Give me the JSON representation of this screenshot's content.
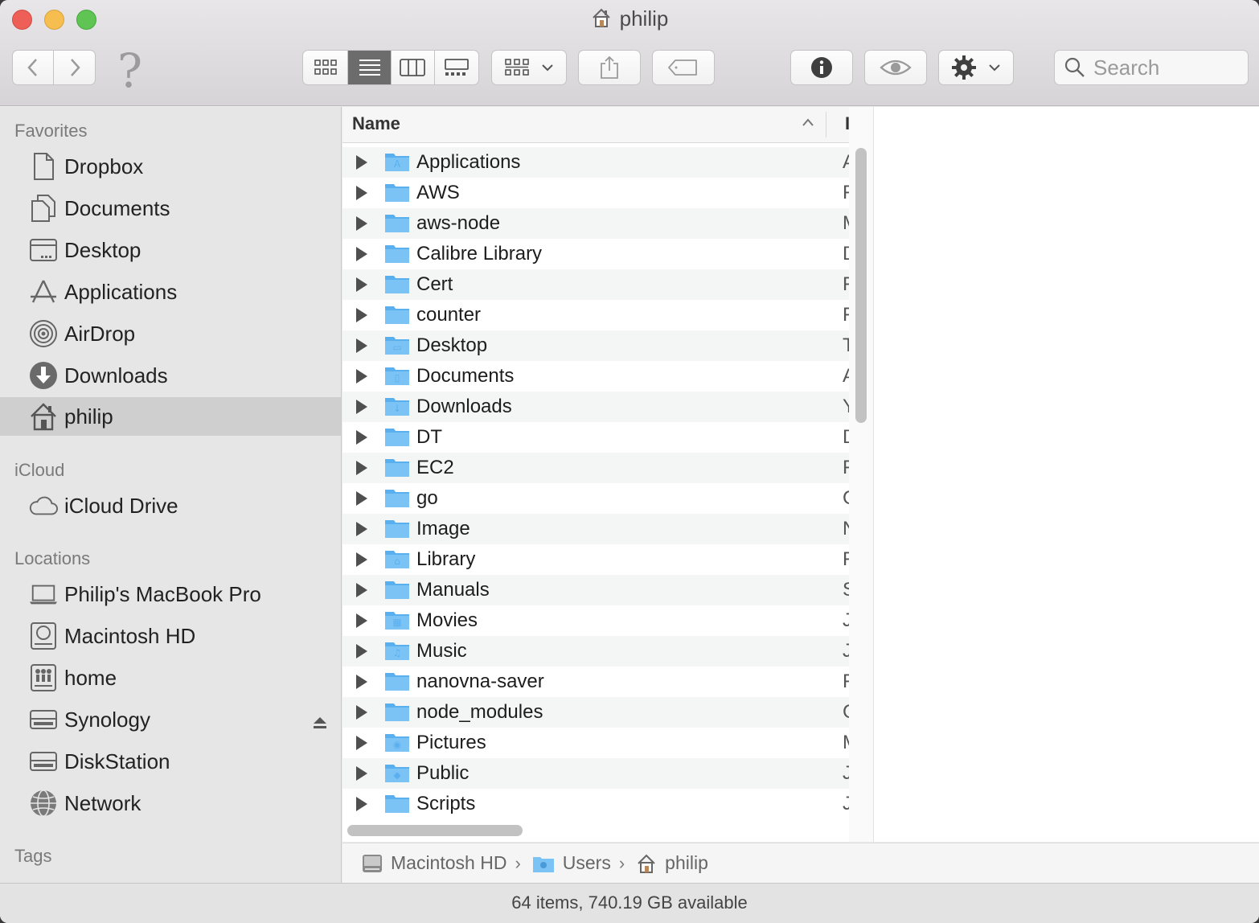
{
  "window": {
    "title": "philip"
  },
  "toolbar": {
    "search_placeholder": "Search",
    "help_glyph": "?"
  },
  "sidebar": {
    "favorites_header": "Favorites",
    "favorites": [
      {
        "label": "Dropbox",
        "icon": "document-icon"
      },
      {
        "label": "Documents",
        "icon": "documents-icon"
      },
      {
        "label": "Desktop",
        "icon": "desktop-icon"
      },
      {
        "label": "Applications",
        "icon": "applications-icon"
      },
      {
        "label": "AirDrop",
        "icon": "airdrop-icon"
      },
      {
        "label": "Downloads",
        "icon": "downloads-icon"
      },
      {
        "label": "philip",
        "icon": "home-icon",
        "selected": true
      }
    ],
    "icloud_header": "iCloud",
    "icloud": [
      {
        "label": "iCloud Drive",
        "icon": "cloud-icon"
      }
    ],
    "locations_header": "Locations",
    "locations": [
      {
        "label": "Philip's MacBook Pro",
        "icon": "laptop-icon"
      },
      {
        "label": "Macintosh HD",
        "icon": "hard-drive-icon"
      },
      {
        "label": "home",
        "icon": "network-share-icon"
      },
      {
        "label": "Synology",
        "icon": "server-icon",
        "ejectable": true
      },
      {
        "label": "DiskStation",
        "icon": "server-icon"
      },
      {
        "label": "Network",
        "icon": "globe-icon"
      }
    ],
    "tags_header": "Tags"
  },
  "list": {
    "column_name": "Name",
    "next_column_initial": "I",
    "rows": [
      {
        "name": "Applications",
        "next": "A",
        "badge": "A"
      },
      {
        "name": "AWS",
        "next": "F"
      },
      {
        "name": "aws-node",
        "next": "M"
      },
      {
        "name": "Calibre Library",
        "next": "D"
      },
      {
        "name": "Cert",
        "next": "F"
      },
      {
        "name": "counter",
        "next": "F"
      },
      {
        "name": "Desktop",
        "next": "T",
        "badge": "▭"
      },
      {
        "name": "Documents",
        "next": "A",
        "badge": "▯"
      },
      {
        "name": "Downloads",
        "next": "Y",
        "badge": "↓"
      },
      {
        "name": "DT",
        "next": "D"
      },
      {
        "name": "EC2",
        "next": "F"
      },
      {
        "name": "go",
        "next": "C"
      },
      {
        "name": "Image",
        "next": "N"
      },
      {
        "name": "Library",
        "next": "F",
        "badge": "⌂"
      },
      {
        "name": "Manuals",
        "next": "S"
      },
      {
        "name": "Movies",
        "next": "J",
        "badge": "▦"
      },
      {
        "name": "Music",
        "next": "J",
        "badge": "♫"
      },
      {
        "name": "nanovna-saver",
        "next": "F"
      },
      {
        "name": "node_modules",
        "next": "C"
      },
      {
        "name": "Pictures",
        "next": "M",
        "badge": "◉"
      },
      {
        "name": "Public",
        "next": "J",
        "badge": "◆"
      },
      {
        "name": "Scripts",
        "next": "J"
      }
    ]
  },
  "pathbar": [
    {
      "label": "Macintosh HD",
      "icon": "hard-drive-icon"
    },
    {
      "label": "Users",
      "icon": "folder-icon"
    },
    {
      "label": "philip",
      "icon": "home-icon"
    }
  ],
  "status": {
    "text": "64 items, 740.19 GB available"
  },
  "colors": {
    "folder": "#7cc3f5",
    "folder_dark": "#5ab0ee",
    "selection": "#cfcfcf"
  }
}
